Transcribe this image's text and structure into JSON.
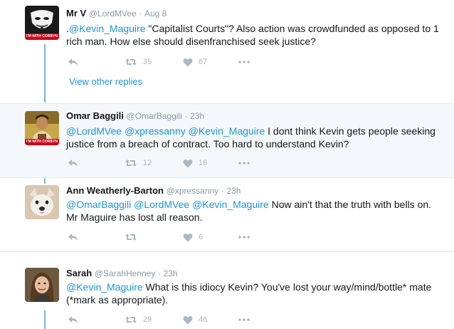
{
  "tweets": [
    {
      "name": "Mr V",
      "handle": "@LordMVee",
      "time": "Aug 8",
      "text_parts": [
        {
          "t": ".",
          "m": false
        },
        {
          "t": "@Kevin_Maguire",
          "m": true
        },
        {
          "t": " \"Capitalist Courts\"?  Also action was crowdfunded as opposed to 1 rich man. How else should disenfranchised seek justice?",
          "m": false
        }
      ],
      "retweets": "35",
      "likes": "67",
      "badge": "I'M WITH CORBYN",
      "avatar": "anonymous-mask"
    },
    {
      "name": "Omar Baggili",
      "handle": "@OmarBaggili",
      "time": "23h",
      "text_parts": [
        {
          "t": "@LordMVee",
          "m": true
        },
        {
          "t": " ",
          "m": false
        },
        {
          "t": "@xpressanny",
          "m": true
        },
        {
          "t": " ",
          "m": false
        },
        {
          "t": "@Kevin_Maguire",
          "m": true
        },
        {
          "t": " I dont think Kevin gets people seeking justice from a breach of contract. Too hard to understand Kevin?",
          "m": false
        }
      ],
      "retweets": "12",
      "likes": "18",
      "badge": "I'M WITH CORBYN",
      "avatar": "person-photo"
    },
    {
      "name": "Ann Weatherly-Barton",
      "handle": "@xpressanny",
      "time": "23h",
      "text_parts": [
        {
          "t": "@OmarBaggili",
          "m": true
        },
        {
          "t": " ",
          "m": false
        },
        {
          "t": "@LordMVee",
          "m": true
        },
        {
          "t": " ",
          "m": false
        },
        {
          "t": "@Kevin_Maguire",
          "m": true
        },
        {
          "t": " Now ain't that the truth with bells on. Mr Maguire has lost all reason.",
          "m": false
        }
      ],
      "retweets": "",
      "likes": "6",
      "avatar": "dog-photo"
    },
    {
      "name": "Sarah",
      "handle": "@SarahHenney",
      "time": "23h",
      "text_parts": [
        {
          "t": "@Kevin_Maguire",
          "m": true
        },
        {
          "t": " What is this idiocy Kevin? You've lost your way/mind/bottle* mate (*mark as appropriate).",
          "m": false
        }
      ],
      "retweets": "29",
      "likes": "46",
      "avatar": "woman-photo"
    }
  ],
  "view_other_replies": "View other replies",
  "separator_dot": "·",
  "colors": {
    "link": "#1b95e0",
    "muted": "#8899a6",
    "icon": "#aab8c2",
    "thread_line": "#7fb5d5",
    "highlight_bg": "#f5f8fa",
    "badge_red": "#d0021b"
  }
}
